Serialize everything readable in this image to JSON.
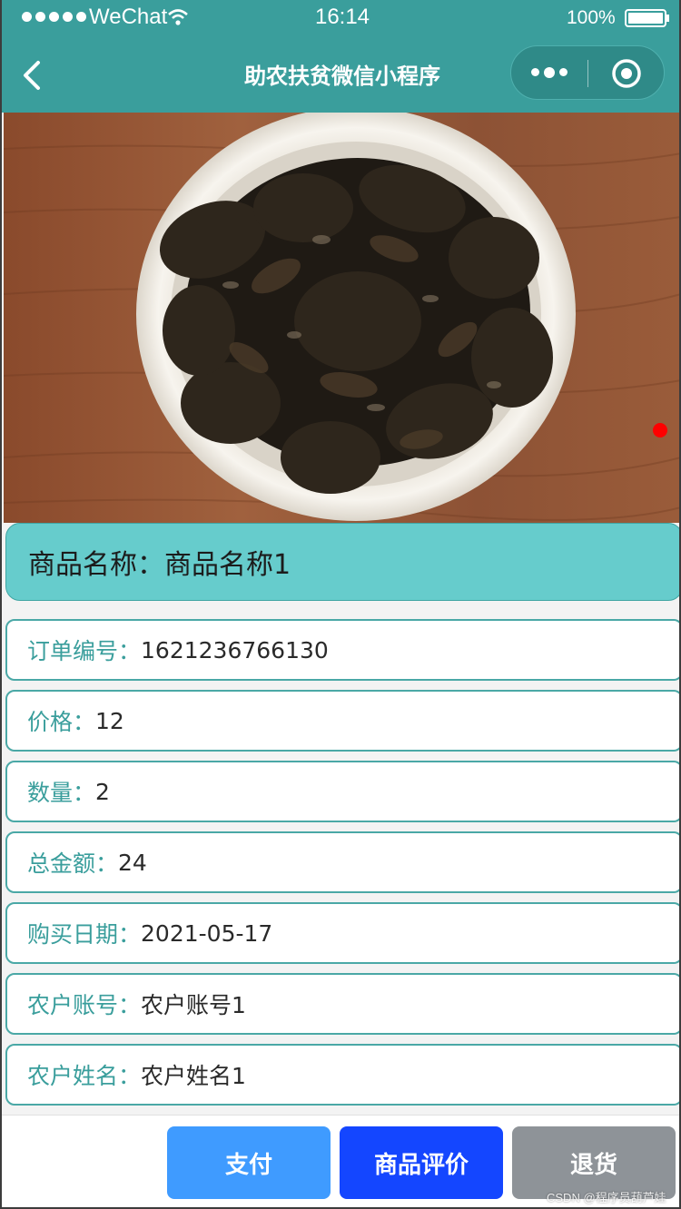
{
  "status_bar": {
    "carrier": "WeChat",
    "time": "16:14",
    "battery_percent": "100%"
  },
  "nav": {
    "title": "助农扶贫微信小程序",
    "back_icon": "chevron-left-icon",
    "more_icon": "more-dots-icon",
    "close_icon": "target-circle-icon"
  },
  "product": {
    "image": "plate-of-black-fungus",
    "carousel_indicator_color": "#ff0000",
    "name_label": "商品名称：",
    "name_value": "商品名称1"
  },
  "order_fields": [
    {
      "label": "订单编号：",
      "value": "1621236766130"
    },
    {
      "label": "价格：",
      "value": "12"
    },
    {
      "label": "数量：",
      "value": "2"
    },
    {
      "label": "总金额：",
      "value": "24"
    },
    {
      "label": "购买日期：",
      "value": "2021-05-17"
    },
    {
      "label": "农户账号：",
      "value": "农户账号1"
    },
    {
      "label": "农户姓名：",
      "value": "农户姓名1"
    }
  ],
  "actions": {
    "pay": "支付",
    "review": "商品评价",
    "refund": "退货"
  },
  "watermark": "CSDN @程序员葫芦娃",
  "colors": {
    "theme": "#3a9e9c",
    "name_card": "#66cccc",
    "pay_button": "#3f9bff",
    "review_button": "#1446ff",
    "refund_button": "#8e9398"
  }
}
